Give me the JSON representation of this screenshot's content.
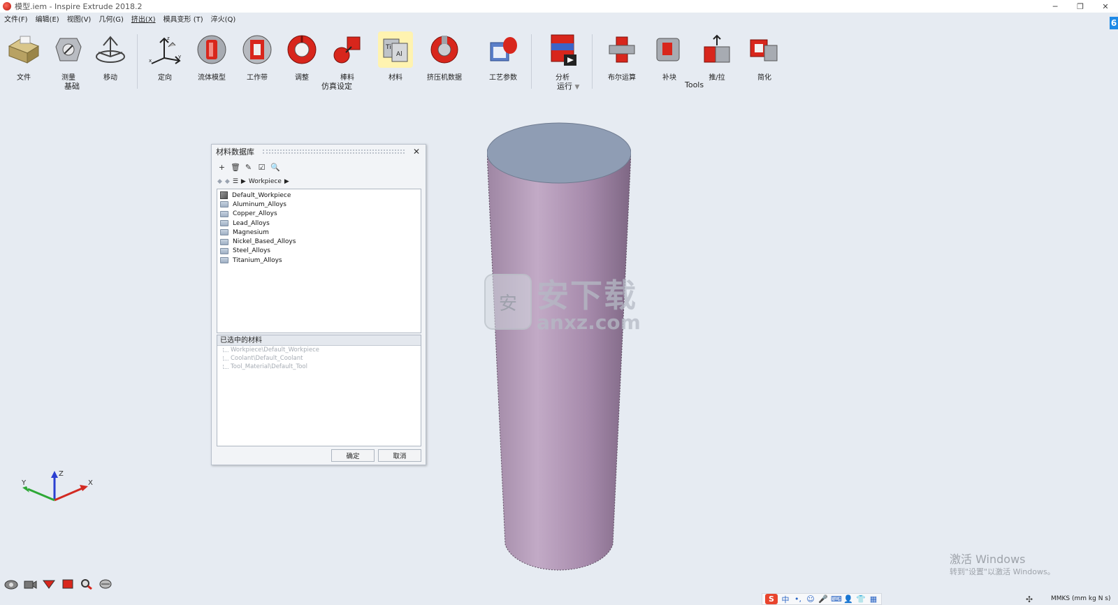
{
  "window": {
    "title": "模型.iem - Inspire Extrude 2018.2",
    "controls": [
      "─",
      "❐",
      "✕"
    ]
  },
  "menu": {
    "items": [
      "文件(F)",
      "编辑(E)",
      "视图(V)",
      "几何(G)",
      "挤出(X)",
      "模具变形 (T)",
      "淬火(Q)"
    ],
    "active_index": 4
  },
  "ribbon": {
    "tools": {
      "file": "文件",
      "measure": "测量",
      "move": "移动",
      "orient": "定向",
      "fluid_model": "流体模型",
      "bearing": "工作带",
      "adjust": "调整",
      "billet": "棒料",
      "material": "材料",
      "press_data": "挤压机数据",
      "process_params": "工艺参数",
      "analyze": "分析",
      "boolean": "布尔运算",
      "patch": "补块",
      "push_pull": "推/拉",
      "simplify": "简化"
    },
    "groups": {
      "basic": "基础",
      "sim_setup": "仿真设定",
      "run": "运行",
      "tools": "Tools"
    }
  },
  "dialog": {
    "title": "材料数据库",
    "close": "✕",
    "toolbar": [
      "+",
      "🗑",
      "✎",
      "☑",
      "🔍"
    ],
    "breadcrumb": "Workpiece",
    "tree": [
      {
        "label": "Default_Workpiece",
        "icon": "cube-icon"
      },
      {
        "label": "Aluminum_Alloys",
        "icon": "folder-icon"
      },
      {
        "label": "Copper_Alloys",
        "icon": "folder-icon"
      },
      {
        "label": "Lead_Alloys",
        "icon": "folder-icon"
      },
      {
        "label": "Magnesium",
        "icon": "folder-icon"
      },
      {
        "label": "Nickel_Based_Alloys",
        "icon": "folder-icon"
      },
      {
        "label": "Steel_Alloys",
        "icon": "folder-icon"
      },
      {
        "label": "Titanium_Alloys",
        "icon": "folder-icon"
      }
    ],
    "selected_header": "已选中的材料",
    "selected": [
      "Workpiece\\Default_Workpiece",
      "Coolant\\Default_Coolant",
      "Tool_Material\\Default_Tool"
    ],
    "ok": "确定",
    "cancel": "取消"
  },
  "triad": {
    "x": "X",
    "y": "Y",
    "z": "Z"
  },
  "watermark": {
    "main": "安下载",
    "sub": "anxz.com"
  },
  "activate": {
    "line1": "激活 Windows",
    "line2": "转到\"设置\"以激活 Windows。"
  },
  "status": {
    "ime": [
      "中",
      "•,",
      "☺",
      "🎤",
      "⌨",
      "👤",
      "👕",
      "▦"
    ],
    "units": "MMKS (mm kg N s)"
  },
  "colors": {
    "background": "#e6ebf2",
    "cylinder_side": "#b79fbb",
    "cylinder_top": "#8f9db4",
    "brand_red": "#d8261c",
    "ime_accent": "#e8442d"
  }
}
